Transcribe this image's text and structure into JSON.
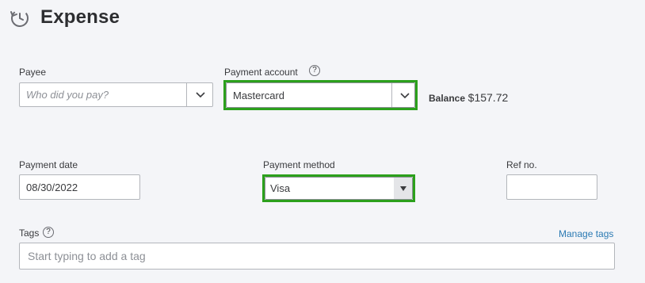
{
  "header": {
    "title": "Expense",
    "icon": "clock-arrow-icon"
  },
  "payee": {
    "label": "Payee",
    "placeholder": "Who did you pay?",
    "icon": "chevron-down-icon"
  },
  "payment_account": {
    "label": "Payment account",
    "help": "?",
    "value": "Mastercard",
    "icon": "chevron-down-icon"
  },
  "balance": {
    "label": "Balance",
    "value": "$157.72"
  },
  "payment_date": {
    "label": "Payment date",
    "value": "08/30/2022"
  },
  "payment_method": {
    "label": "Payment method",
    "value": "Visa",
    "icon": "triangle-down-icon"
  },
  "ref_no": {
    "label": "Ref no.",
    "value": ""
  },
  "tags": {
    "label": "Tags",
    "help": "?",
    "manage_label": "Manage tags",
    "placeholder": "Start typing to add a tag"
  },
  "colors": {
    "highlight": "#2ca01c",
    "link": "#2b7ab3",
    "border": "#b3b6bb"
  }
}
